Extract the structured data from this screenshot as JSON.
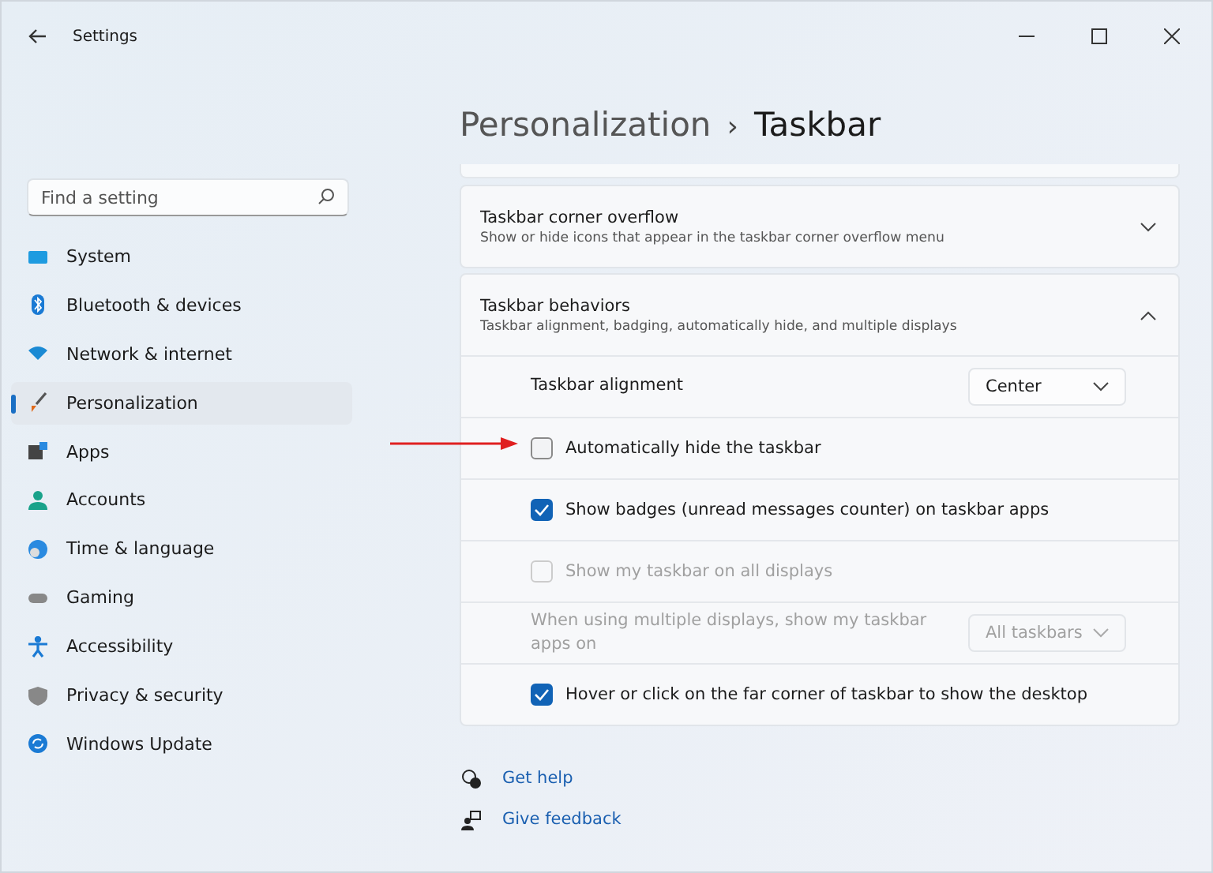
{
  "window": {
    "title": "Settings"
  },
  "search": {
    "placeholder": "Find a setting"
  },
  "sidebar": {
    "items": [
      {
        "label": "System",
        "selected": false
      },
      {
        "label": "Bluetooth & devices",
        "selected": false
      },
      {
        "label": "Network & internet",
        "selected": false
      },
      {
        "label": "Personalization",
        "selected": true
      },
      {
        "label": "Apps",
        "selected": false
      },
      {
        "label": "Accounts",
        "selected": false
      },
      {
        "label": "Time & language",
        "selected": false
      },
      {
        "label": "Gaming",
        "selected": false
      },
      {
        "label": "Accessibility",
        "selected": false
      },
      {
        "label": "Privacy & security",
        "selected": false
      },
      {
        "label": "Windows Update",
        "selected": false
      }
    ]
  },
  "breadcrumb": {
    "parent": "Personalization",
    "separator": "›",
    "current": "Taskbar"
  },
  "sections": [
    {
      "title": "Taskbar corner overflow",
      "description": "Show or hide icons that appear in the taskbar corner overflow menu",
      "expanded": false
    },
    {
      "title": "Taskbar behaviors",
      "description": "Taskbar alignment, badging, automatically hide, and multiple displays",
      "expanded": true,
      "rows": [
        {
          "kind": "dropdown",
          "label": "Taskbar alignment",
          "value": "Center",
          "disabled": false
        },
        {
          "kind": "checkbox",
          "label": "Automatically hide the taskbar",
          "checked": false,
          "disabled": false
        },
        {
          "kind": "checkbox",
          "label": "Show badges (unread messages counter) on taskbar apps",
          "checked": true,
          "disabled": false
        },
        {
          "kind": "checkbox",
          "label": "Show my taskbar on all displays",
          "checked": false,
          "disabled": true
        },
        {
          "kind": "dropdown",
          "label": "When using multiple displays, show my taskbar apps on",
          "value": "All taskbars",
          "disabled": true
        },
        {
          "kind": "checkbox",
          "label": "Hover or click on the far corner of taskbar to show the desktop",
          "checked": true,
          "disabled": false
        }
      ]
    }
  ],
  "links": [
    {
      "label": "Get help"
    },
    {
      "label": "Give feedback"
    }
  ]
}
